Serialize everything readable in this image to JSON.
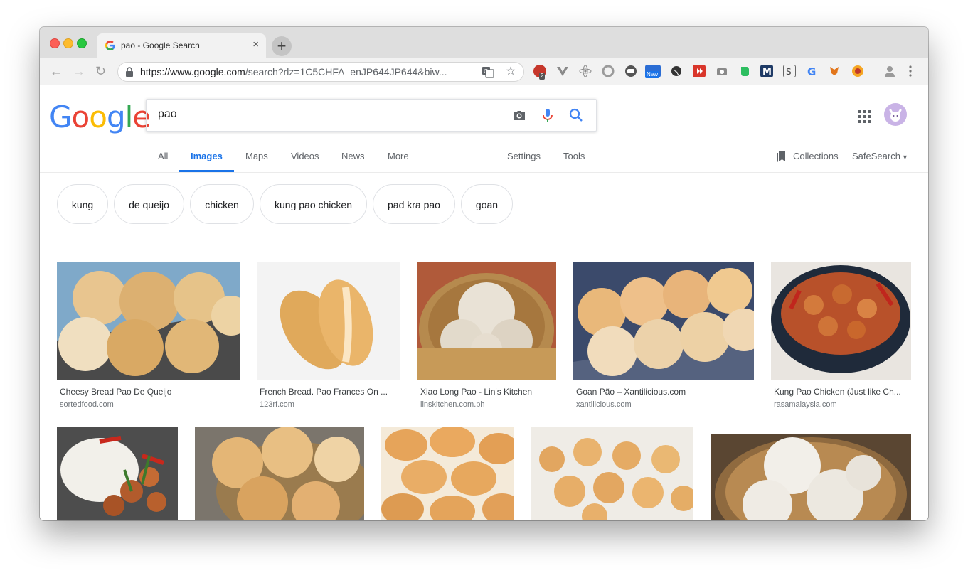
{
  "browser": {
    "tab_title": "pao - Google Search",
    "tab_close": "×",
    "new_tab": "+",
    "url_host": "https://www.google.com",
    "url_path": "/search?rlz=1C5CHFA_enJP644JP644&biw...",
    "extension_badge_count": "2",
    "extension_badge_new": "New"
  },
  "google": {
    "logo_letters": [
      "G",
      "o",
      "o",
      "g",
      "l",
      "e"
    ],
    "logo_colors": [
      "#4285F4",
      "#EA4335",
      "#FBBC05",
      "#4285F4",
      "#34A853",
      "#EA4335"
    ],
    "query": "pao"
  },
  "nav": {
    "tabs": [
      "All",
      "Images",
      "Maps",
      "Videos",
      "News",
      "More"
    ],
    "active": "Images",
    "settings": "Settings",
    "tools": "Tools",
    "collections": "Collections",
    "safesearch": "SafeSearch"
  },
  "chips": [
    "kung",
    "de queijo",
    "chicken",
    "kung pao chicken",
    "pad kra pao",
    "goan"
  ],
  "results_row1": [
    {
      "title": "Cheesy Bread Pao De Queijo",
      "source": "sortedfood.com"
    },
    {
      "title": "French Bread. Pao Frances On ...",
      "source": "123rf.com"
    },
    {
      "title": "Xiao Long Pao - Lin's Kitchen",
      "source": "linskitchen.com.ph"
    },
    {
      "title": "Goan Pão – Xantilicious.com",
      "source": "xantilicious.com"
    },
    {
      "title": "Kung Pao Chicken (Just like Ch...",
      "source": "rasamalaysia.com"
    }
  ]
}
